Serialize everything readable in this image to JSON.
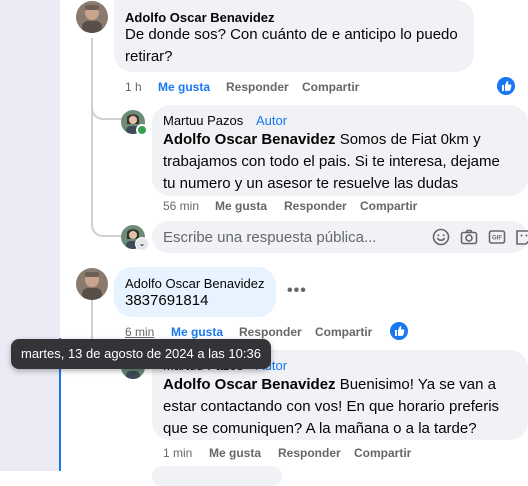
{
  "comments": [
    {
      "author": "Adolfo Oscar Benavidez",
      "text": "De donde sos? Con cuánto de e anticipo lo puedo retirar?",
      "time": "1 h",
      "like": "Me gusta",
      "reply": "Responder",
      "share": "Compartir"
    },
    {
      "author": "Martuu Pazos",
      "badge": "Autor",
      "mention": "Adolfo Oscar Benavidez",
      "text": " Somos de Fiat 0km y trabajamos con todo el pais. Si te interesa, dejame tu numero y un asesor te resuelve las dudas",
      "time": "56 min",
      "like": "Me gusta",
      "reply": "Responder",
      "share": "Compartir"
    },
    {
      "author": "Adolfo Oscar Benavidez",
      "text": "3837691814",
      "time": "6 min",
      "like": "Me gusta",
      "reply": "Responder",
      "share": "Compartir",
      "more": "•••"
    },
    {
      "author": "Martuu Pazos",
      "badge": "Autor",
      "mention": "Adolfo Oscar Benavidez",
      "text": " Buenisimo! Ya se van a estar contactando con vos! En que horario preferis que se comuniquen? A la mañana o a la tarde?",
      "time": "1 min",
      "like": "Me gusta",
      "reply": "Responder",
      "share": "Compartir"
    }
  ],
  "reply_box": {
    "placeholder": "Escribe una respuesta pública..."
  },
  "reply_tools": [
    "emoji-icon",
    "camera-icon",
    "gif-icon",
    "sticker-icon"
  ],
  "tooltip": "martes, 13 de agosto de 2024 a las 10:36",
  "colors": {
    "accent": "#1877f2",
    "bubble": "#f0f2f5",
    "bubble_active": "#e7f3ff",
    "online": "#31a24c"
  }
}
